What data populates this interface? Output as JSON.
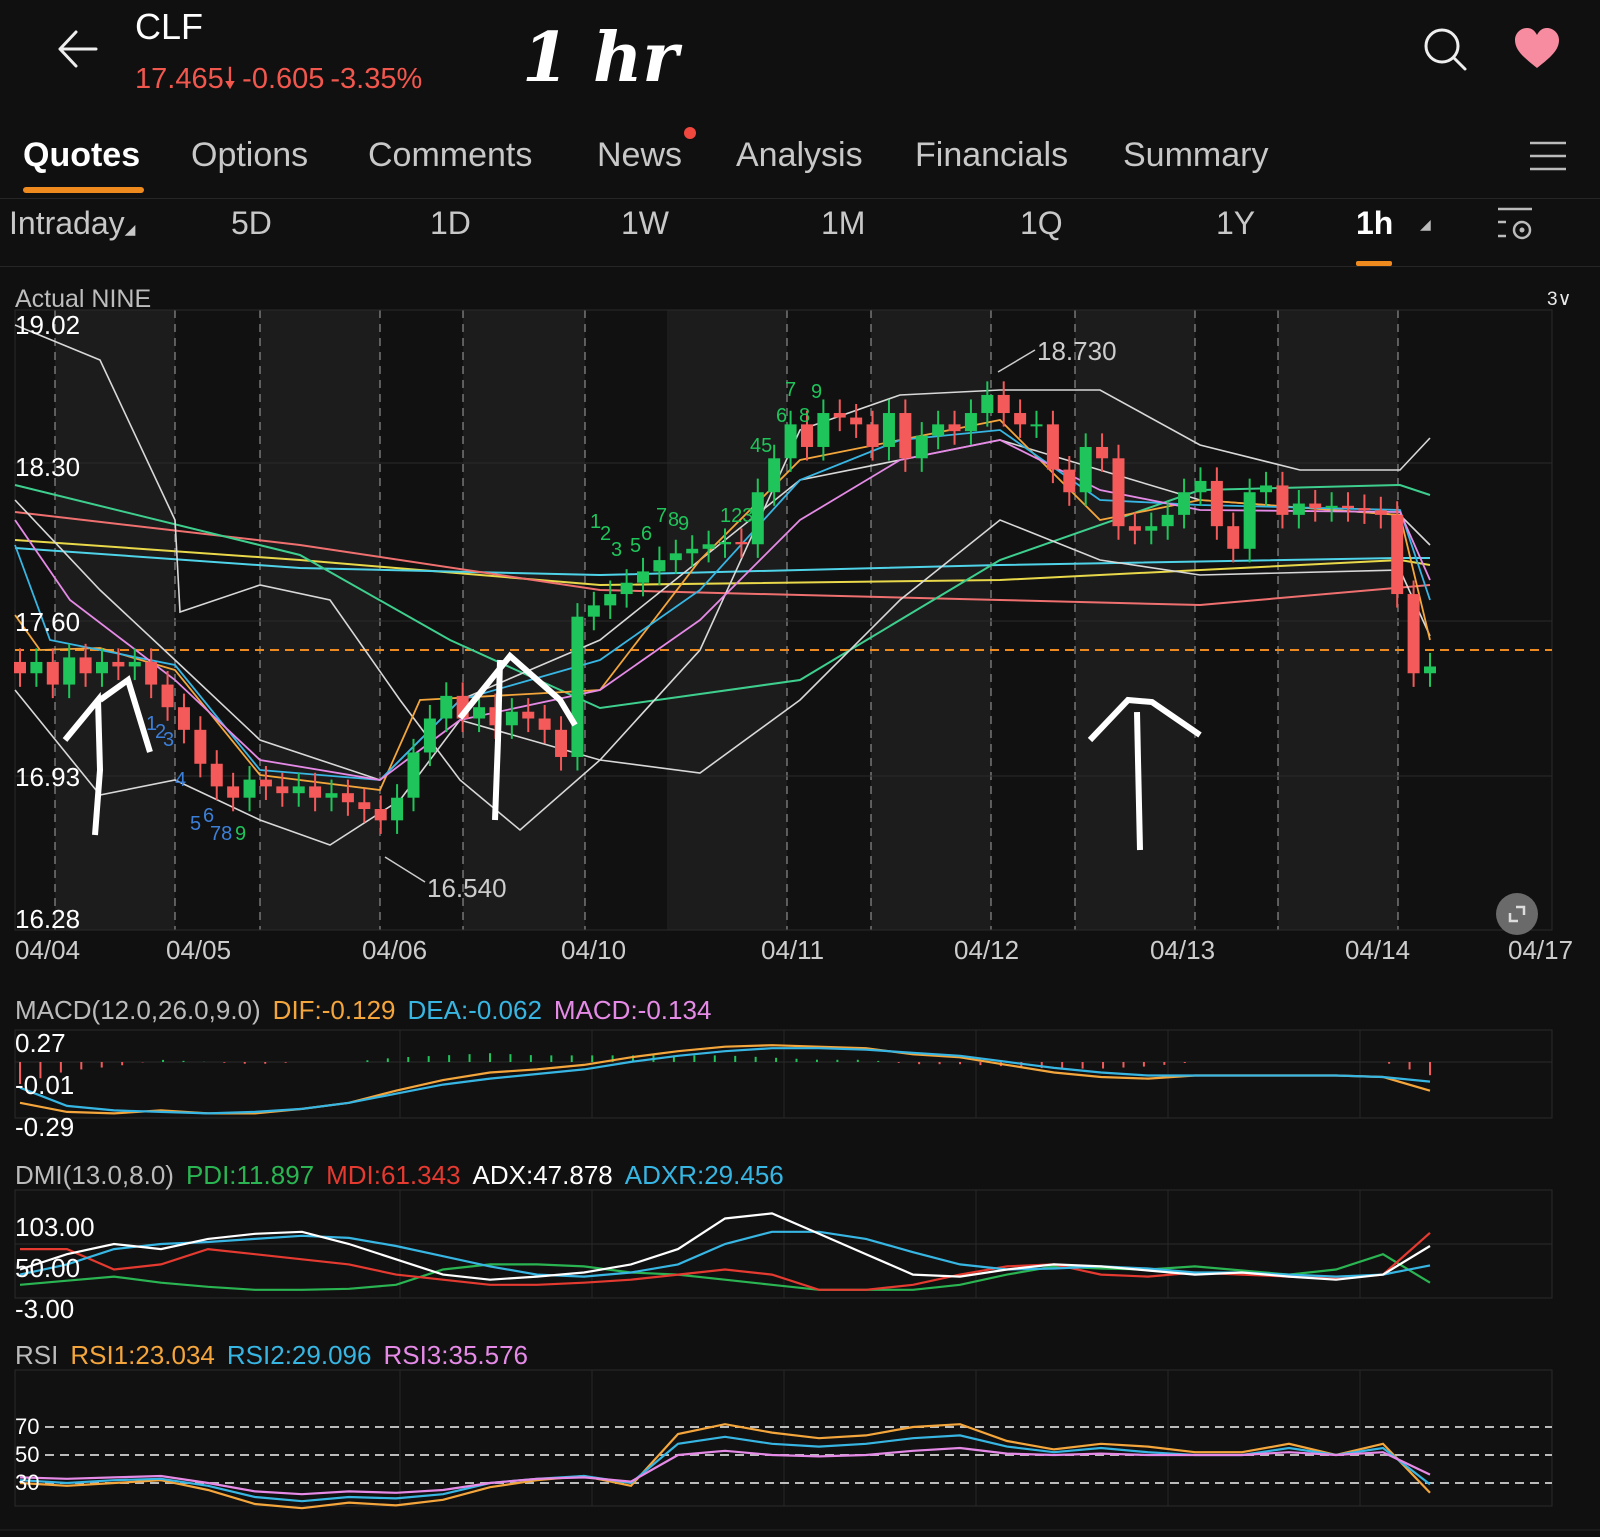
{
  "header": {
    "ticker": "CLF",
    "price": "17.465",
    "change": "-0.605",
    "change_pct": "-3.35%",
    "annotation": "1 hr",
    "icons": [
      "back-arrow-icon",
      "search-icon",
      "heart-icon"
    ]
  },
  "tabs": {
    "items": [
      {
        "label": "Quotes",
        "active": true
      },
      {
        "label": "Options"
      },
      {
        "label": "Comments"
      },
      {
        "label": "News",
        "badge": "dot"
      },
      {
        "label": "Analysis"
      },
      {
        "label": "Financials"
      },
      {
        "label": "Summary"
      }
    ]
  },
  "ranges": {
    "items": [
      {
        "label": "Intraday"
      },
      {
        "label": "5D"
      },
      {
        "label": "1D"
      },
      {
        "label": "1W"
      },
      {
        "label": "1M"
      },
      {
        "label": "1Q"
      },
      {
        "label": "1Y"
      },
      {
        "label": "1h",
        "active": true
      }
    ]
  },
  "main_chart": {
    "title": "Actual  NINE",
    "scale_selector": "3∨",
    "y_ticks": [
      "19.02",
      "18.30",
      "17.60",
      "16.93",
      "16.28"
    ],
    "x_ticks": [
      "04/04",
      "04/05",
      "04/06",
      "04/10",
      "04/11",
      "04/12",
      "04/13",
      "04/14",
      "04/17"
    ],
    "high_label": "18.730",
    "low_label": "16.540",
    "last_price": 17.465
  },
  "macd": {
    "label": "MACD(12.0,26.0,9.0)",
    "dif": "DIF:-0.129",
    "dea": "DEA:-0.062",
    "macd": "MACD:-0.134",
    "y_ticks": [
      "0.27",
      "-0.01",
      "-0.29"
    ]
  },
  "dmi": {
    "label": "DMI(13.0,8.0)",
    "pdi": "PDI:11.897",
    "mdi": "MDI:61.343",
    "adx": "ADX:47.878",
    "adxr": "ADXR:29.456",
    "y_ticks": [
      "103.00",
      "50.00",
      "-3.00"
    ]
  },
  "rsi": {
    "label": "RSI",
    "rsi1": "RSI1:23.034",
    "rsi2": "RSI2:29.096",
    "rsi3": "RSI3:35.576",
    "y_ticks": [
      "70",
      "50",
      "30"
    ]
  },
  "colors": {
    "up": "#1fc45a",
    "down": "#f45a5a",
    "accent": "#ef8a1f",
    "dif": "#f4a63c",
    "dea": "#38b6e3",
    "macd": "#e58ae6",
    "pdi": "#2ab552",
    "mdi": "#e53a30",
    "adx": "#ffffff",
    "adxr": "#38b6e3"
  },
  "chart_data": {
    "type": "candlestick",
    "title": "CLF 1h",
    "xlabel": "",
    "ylabel": "",
    "ylim": [
      16.28,
      19.02
    ],
    "x": [
      "04/04",
      "04/05",
      "04/06",
      "04/10",
      "04/11",
      "04/12",
      "04/13",
      "04/14",
      "04/17"
    ],
    "candles_close": [
      17.45,
      17.5,
      17.4,
      17.52,
      17.45,
      17.5,
      17.48,
      17.5,
      17.4,
      17.3,
      17.2,
      17.05,
      16.95,
      16.9,
      16.98,
      16.95,
      16.92,
      16.95,
      16.9,
      16.92,
      16.88,
      16.85,
      16.8,
      16.9,
      17.1,
      17.25,
      17.35,
      17.25,
      17.3,
      17.22,
      17.28,
      17.25,
      17.2,
      17.08,
      17.7,
      17.75,
      17.8,
      17.85,
      17.9,
      17.95,
      17.98,
      18.0,
      18.02,
      18.03,
      18.02,
      18.25,
      18.4,
      18.55,
      18.45,
      18.6,
      18.58,
      18.55,
      18.45,
      18.6,
      18.4,
      18.5,
      18.55,
      18.52,
      18.6,
      18.68,
      18.6,
      18.55,
      18.55,
      18.35,
      18.25,
      18.45,
      18.4,
      18.1,
      18.08,
      18.1,
      18.15,
      18.25,
      18.3,
      18.1,
      18.0,
      18.25,
      18.28,
      18.15,
      18.2,
      18.18,
      18.19,
      18.18,
      18.17,
      18.15,
      17.8,
      17.45,
      17.48
    ],
    "series": [
      {
        "name": "MACD DIF",
        "values": [
          -0.2,
          -0.26,
          -0.27,
          -0.25,
          -0.27,
          -0.27,
          -0.24,
          -0.2,
          -0.12,
          -0.05,
          0.0,
          0.02,
          0.05,
          0.1,
          0.14,
          0.17,
          0.18,
          0.17,
          0.16,
          0.12,
          0.1,
          0.05,
          0.0,
          -0.03,
          -0.04,
          -0.02,
          -0.02,
          -0.02,
          -0.02,
          -0.03,
          -0.12
        ]
      },
      {
        "name": "MACD DEA",
        "values": [
          -0.1,
          -0.22,
          -0.25,
          -0.26,
          -0.27,
          -0.26,
          -0.24,
          -0.2,
          -0.14,
          -0.08,
          -0.04,
          -0.01,
          0.02,
          0.07,
          0.11,
          0.14,
          0.16,
          0.16,
          0.15,
          0.13,
          0.11,
          0.07,
          0.03,
          0.0,
          -0.02,
          -0.02,
          -0.02,
          -0.02,
          -0.02,
          -0.03,
          -0.06
        ]
      },
      {
        "name": "PDI",
        "values": [
          10,
          14,
          18,
          12,
          8,
          5,
          5,
          6,
          10,
          25,
          30,
          30,
          28,
          22,
          20,
          15,
          10,
          5,
          5,
          5,
          10,
          20,
          28,
          26,
          25,
          28,
          24,
          20,
          25,
          40,
          12
        ]
      },
      {
        "name": "MDI",
        "values": [
          45,
          45,
          25,
          30,
          45,
          40,
          35,
          30,
          20,
          15,
          10,
          10,
          12,
          15,
          20,
          25,
          20,
          5,
          5,
          10,
          20,
          28,
          30,
          20,
          18,
          22,
          20,
          18,
          16,
          20,
          61
        ]
      },
      {
        "name": "ADX",
        "values": [
          25,
          40,
          50,
          45,
          55,
          60,
          62,
          50,
          35,
          20,
          15,
          18,
          22,
          30,
          45,
          75,
          80,
          60,
          40,
          20,
          18,
          25,
          30,
          28,
          24,
          20,
          22,
          18,
          15,
          20,
          48
        ]
      },
      {
        "name": "ADXR",
        "values": [
          20,
          30,
          45,
          50,
          52,
          55,
          58,
          56,
          48,
          38,
          28,
          20,
          18,
          22,
          30,
          50,
          62,
          62,
          55,
          42,
          30,
          25,
          26,
          28,
          26,
          22,
          22,
          20,
          18,
          20,
          29
        ]
      },
      {
        "name": "RSI1",
        "values": [
          30,
          28,
          30,
          32,
          25,
          15,
          12,
          16,
          14,
          18,
          27,
          32,
          35,
          28,
          65,
          72,
          66,
          62,
          64,
          70,
          72,
          60,
          54,
          58,
          56,
          52,
          52,
          58,
          50,
          58,
          23
        ]
      },
      {
        "name": "RSI2",
        "values": [
          32,
          30,
          32,
          33,
          28,
          20,
          17,
          20,
          19,
          22,
          30,
          33,
          35,
          30,
          58,
          63,
          58,
          56,
          58,
          62,
          64,
          56,
          52,
          55,
          52,
          50,
          50,
          55,
          50,
          55,
          29
        ]
      },
      {
        "name": "RSI3",
        "values": [
          34,
          33,
          34,
          35,
          30,
          24,
          22,
          24,
          23,
          25,
          30,
          33,
          34,
          31,
          50,
          53,
          50,
          49,
          50,
          53,
          55,
          51,
          50,
          51,
          50,
          50,
          50,
          52,
          50,
          52,
          36
        ]
      }
    ]
  }
}
